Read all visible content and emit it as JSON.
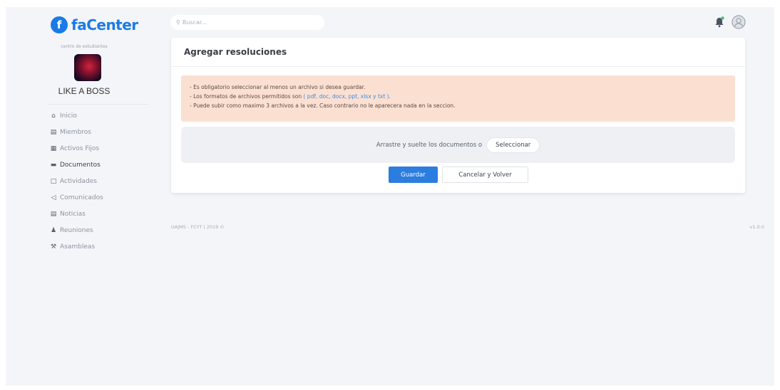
{
  "brand": {
    "logo_letter": "f",
    "name": "faCenter",
    "color": "#1b7be6"
  },
  "org": {
    "caption": "centro de estudiantes",
    "name": "LIKE A BOSS"
  },
  "sidebar": {
    "items": [
      {
        "icon": "home-icon",
        "glyph": "⌂",
        "label": "Inicio"
      },
      {
        "icon": "id-card-icon",
        "glyph": "▤",
        "label": "Miembros"
      },
      {
        "icon": "boxes-icon",
        "glyph": "▦",
        "label": "Activos Fijos"
      },
      {
        "icon": "folder-icon",
        "glyph": "▬",
        "label": "Documentos"
      },
      {
        "icon": "calendar-icon",
        "glyph": "□",
        "label": "Actividades"
      },
      {
        "icon": "megaphone-icon",
        "glyph": "◁",
        "label": "Comunicados"
      },
      {
        "icon": "newspaper-icon",
        "glyph": "▤",
        "label": "Noticias"
      },
      {
        "icon": "users-icon",
        "glyph": "♟",
        "label": "Reuniones"
      },
      {
        "icon": "gavel-icon",
        "glyph": "⚒",
        "label": "Asambleas"
      }
    ]
  },
  "search": {
    "placeholder": "Buscar..."
  },
  "card": {
    "title": "Agregar resoluciones",
    "alert": {
      "line1": "- Es obligatorio seleccionar al menos un archivo si desea guardar.",
      "line2_prefix": "- Los formatos de archivos permitidos son",
      "line2_formats": "( pdf, doc, docx, ppt, xlsx y txt ).",
      "line3": "- Puede subir como maximo 3 archivos a la vez. Caso contrario no le aparecera nada en la seccion."
    },
    "dropzone_text": "Arrastre y suelte los documentos o",
    "select_label": "Seleccionar",
    "save_label": "Guardar",
    "cancel_label": "Cancelar y Volver"
  },
  "footer": {
    "left": "UAJMS - FCYT | 2019 ©",
    "right": "v1.0.0"
  },
  "colors": {
    "primary": "#2b7de0",
    "alert_bg": "#fbe0d2",
    "background": "#f4f5f9"
  }
}
